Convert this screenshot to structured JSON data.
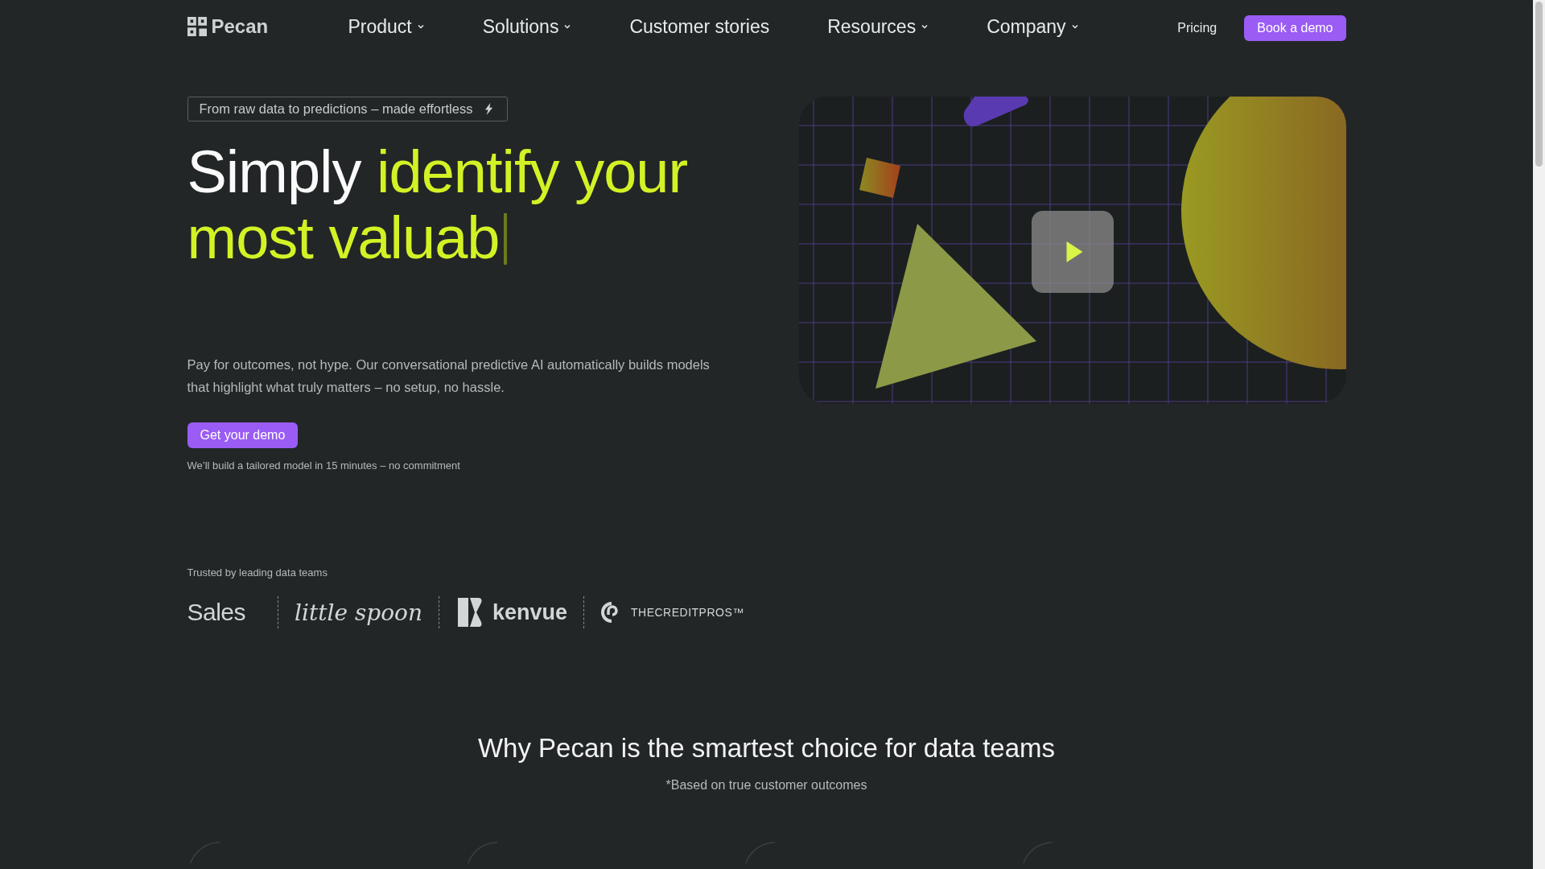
{
  "nav": {
    "logo": "Pecan",
    "items": [
      {
        "label": "Product",
        "dropdown": true
      },
      {
        "label": "Solutions",
        "dropdown": true
      },
      {
        "label": "Customer stories",
        "dropdown": false
      },
      {
        "label": "Resources",
        "dropdown": true
      },
      {
        "label": "Company",
        "dropdown": true
      }
    ],
    "pricing": "Pricing",
    "cta": "Book a demo"
  },
  "hero": {
    "tagline": "From raw data to predictions – made effortless",
    "headline_lead": "Simply",
    "headline_highlight": "identify your most valuab",
    "body": "Pay for outcomes, not hype. Our conversational predictive AI automatically builds models that highlight what truly matters – no setup, no hassle.",
    "button": "Get your demo",
    "note": "We’ll build a tailored model in 15 minutes – no commitment"
  },
  "trusted": {
    "label": "Trusted by leading data teams",
    "logos": [
      {
        "kind": "sans",
        "text": "Sales"
      },
      {
        "kind": "script",
        "text": "little spoon"
      },
      {
        "kind": "kenvue",
        "text": "kenvue"
      },
      {
        "kind": "creditpros",
        "text": "THECREDITPROS™"
      }
    ]
  },
  "why": {
    "title": "Why Pecan is the smartest choice for data teams",
    "subtitle": "*Based on true customer outcomes"
  }
}
